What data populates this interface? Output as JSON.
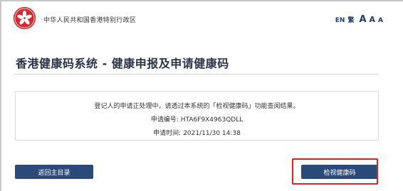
{
  "header": {
    "gov_name": "中华人民共和国香港特别行政区",
    "emblem_icon": "bauhinia-emblem-icon",
    "lang_en": "EN",
    "lang_tc": "繁",
    "font_size_large": "A",
    "font_size_medium": "A",
    "font_size_small": "A"
  },
  "page": {
    "title": "香港健康码系统 - 健康申报及申请健康码"
  },
  "info": {
    "message": "登记人的申请正处理中，请透过本系统的「检视健康码」功能查阅结果。",
    "app_no_label": "申请编号:",
    "app_no_value": "HTA6F9X4963QDLL",
    "app_time_label": "申请时间:",
    "app_time_value": "2021/11/30 14:38"
  },
  "buttons": {
    "back_label": "返回主目录",
    "view_label": "检视健康码"
  },
  "colors": {
    "brand_red": "#d7282f",
    "button_blue": "#2b4a78",
    "highlight_red": "#e02020"
  }
}
